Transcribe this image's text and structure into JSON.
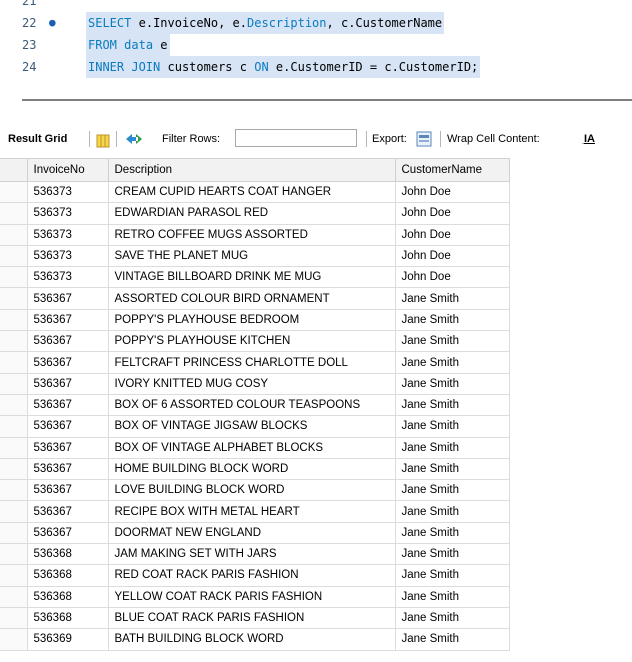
{
  "editor": {
    "lines": [
      {
        "number": "21",
        "text": ""
      },
      {
        "number": "22",
        "text": "SELECT e.InvoiceNo, e.Description, c.CustomerName"
      },
      {
        "number": "23",
        "text": "FROM data e"
      },
      {
        "number": "24",
        "text": "INNER JOIN customers c ON e.CustomerID = c.CustomerID;"
      }
    ]
  },
  "toolbar": {
    "result_grid_label": "Result Grid",
    "filter_rows_label": "Filter Rows:",
    "filter_value": "",
    "export_label": "Export:",
    "wrap_label": "Wrap Cell Content:",
    "wrap_icon_glyph": "I̲A"
  },
  "grid": {
    "columns": [
      "InvoiceNo",
      "Description",
      "CustomerName"
    ],
    "rows": [
      [
        "536373",
        "CREAM CUPID HEARTS COAT HANGER",
        "John Doe"
      ],
      [
        "536373",
        "EDWARDIAN PARASOL RED",
        "John Doe"
      ],
      [
        "536373",
        "RETRO COFFEE MUGS ASSORTED",
        "John Doe"
      ],
      [
        "536373",
        "SAVE THE PLANET MUG",
        "John Doe"
      ],
      [
        "536373",
        "VINTAGE BILLBOARD DRINK ME MUG",
        "John Doe"
      ],
      [
        "536367",
        "ASSORTED COLOUR BIRD ORNAMENT",
        "Jane Smith"
      ],
      [
        "536367",
        "POPPY'S PLAYHOUSE BEDROOM",
        "Jane Smith"
      ],
      [
        "536367",
        "POPPY'S PLAYHOUSE KITCHEN",
        "Jane Smith"
      ],
      [
        "536367",
        "FELTCRAFT PRINCESS CHARLOTTE DOLL",
        "Jane Smith"
      ],
      [
        "536367",
        "IVORY KNITTED MUG COSY",
        "Jane Smith"
      ],
      [
        "536367",
        "BOX OF 6 ASSORTED COLOUR TEASPOONS",
        "Jane Smith"
      ],
      [
        "536367",
        "BOX OF VINTAGE JIGSAW BLOCKS",
        "Jane Smith"
      ],
      [
        "536367",
        "BOX OF VINTAGE ALPHABET BLOCKS",
        "Jane Smith"
      ],
      [
        "536367",
        "HOME BUILDING BLOCK WORD",
        "Jane Smith"
      ],
      [
        "536367",
        "LOVE BUILDING BLOCK WORD",
        "Jane Smith"
      ],
      [
        "536367",
        "RECIPE BOX WITH METAL HEART",
        "Jane Smith"
      ],
      [
        "536367",
        "DOORMAT NEW ENGLAND",
        "Jane Smith"
      ],
      [
        "536368",
        "JAM MAKING SET WITH JARS",
        "Jane Smith"
      ],
      [
        "536368",
        "RED COAT RACK PARIS FASHION",
        "Jane Smith"
      ],
      [
        "536368",
        "YELLOW COAT RACK PARIS FASHION",
        "Jane Smith"
      ],
      [
        "536368",
        "BLUE COAT RACK PARIS FASHION",
        "Jane Smith"
      ],
      [
        "536369",
        "BATH BUILDING BLOCK WORD",
        "Jane Smith"
      ]
    ]
  },
  "colors": {
    "keyword": "#0b7bbf",
    "selection": "#d6e4f5",
    "grid_header": "#f2f2f2"
  },
  "icons": [
    "breakpoint-dot-icon",
    "form-view-icon",
    "refresh-arrows-icon",
    "export-icon",
    "wrap-text-icon"
  ]
}
